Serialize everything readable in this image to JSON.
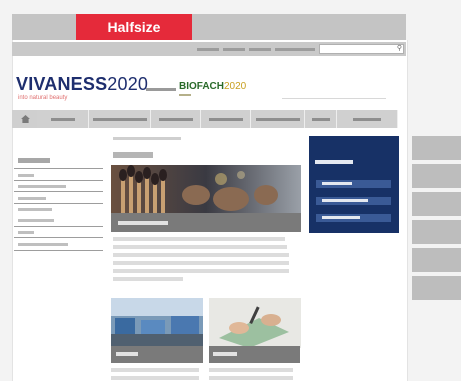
{
  "ad": {
    "label": "Halfsize"
  },
  "header": {
    "logo_main": "VIVANESS",
    "logo_main_year": "2020",
    "logo_tagline": "into natural beauty",
    "logo_second": "BIOFACH",
    "logo_second_year": "2020"
  },
  "colors": {
    "ad_red": "#e52a3a",
    "brand_blue": "#173166",
    "caption_grey": "#7a7a7a"
  },
  "icons": [
    "home-icon",
    "search-icon"
  ]
}
